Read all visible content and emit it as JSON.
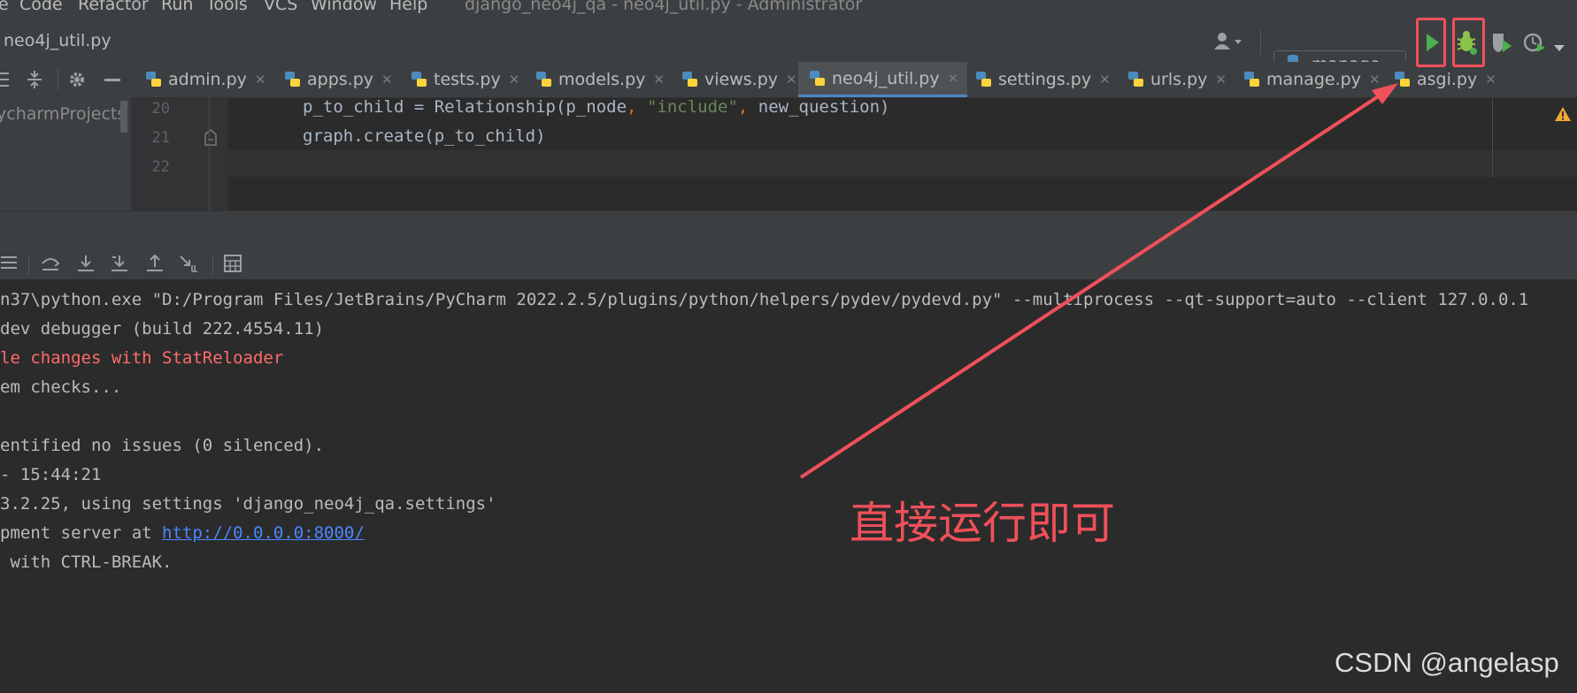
{
  "menu": {
    "items": [
      {
        "label": "e"
      },
      {
        "label": "Code"
      },
      {
        "label": "Refactor"
      },
      {
        "label": "Run"
      },
      {
        "label": "Tools"
      },
      {
        "label": "VCS"
      },
      {
        "label": "Window"
      },
      {
        "label": "Help"
      }
    ],
    "window_title": "django_neo4j_qa - neo4j_util.py - Administrator"
  },
  "navbar": {
    "breadcrumb": "neo4j_util.py",
    "run_config": "manage"
  },
  "tabs": [
    {
      "label": "admin.py"
    },
    {
      "label": "apps.py"
    },
    {
      "label": "tests.py"
    },
    {
      "label": "models.py"
    },
    {
      "label": "views.py"
    },
    {
      "label": "neo4j_util.py",
      "active": true
    },
    {
      "label": "settings.py"
    },
    {
      "label": "urls.py"
    },
    {
      "label": "manage.py"
    },
    {
      "label": "asgi.py"
    }
  ],
  "project": {
    "path_fragment": "ycharmProjects\\基"
  },
  "editor": {
    "lines": [
      {
        "number": "20",
        "code_a": "p_to_child = Relationship(p_node",
        "code_sep1": ", ",
        "code_str": "\"include\"",
        "code_sep2": ", ",
        "code_b": "new_question)"
      },
      {
        "number": "21",
        "code": "graph.create(p_to_child)"
      },
      {
        "number": "22",
        "code": ""
      }
    ]
  },
  "console": {
    "lines": [
      {
        "text": "n37\\python.exe \"D:/Program Files/JetBrains/PyCharm 2022.2.5/plugins/python/helpers/pydev/pydevd.py\" --multiprocess --qt-support=auto --client 127.0.0.1"
      },
      {
        "text": "dev debugger (build 222.4554.11)"
      },
      {
        "text": "le changes with StatReloader",
        "error": true
      },
      {
        "text": "em checks..."
      },
      {
        "text": ""
      },
      {
        "text": "entified no issues (0 silenced)."
      },
      {
        "text": "- 15:44:21"
      },
      {
        "text": "3.2.25, using settings 'django_neo4j_qa.settings'"
      },
      {
        "text_before": "pment server at ",
        "link": "http://0.0.0.0:8000/"
      },
      {
        "text": " with CTRL-BREAK."
      }
    ]
  },
  "annotation": {
    "text": "直接运行即可",
    "color": "#f0505a"
  },
  "watermark": "CSDN @angelasp",
  "colors": {
    "background": "#2b2b2b",
    "chrome": "#3c3f41",
    "accent_red": "#f0505a",
    "run_green": "#4caf50",
    "string_green": "#6a8759",
    "error_red": "#ff6b68",
    "link_blue": "#4a88ff"
  }
}
